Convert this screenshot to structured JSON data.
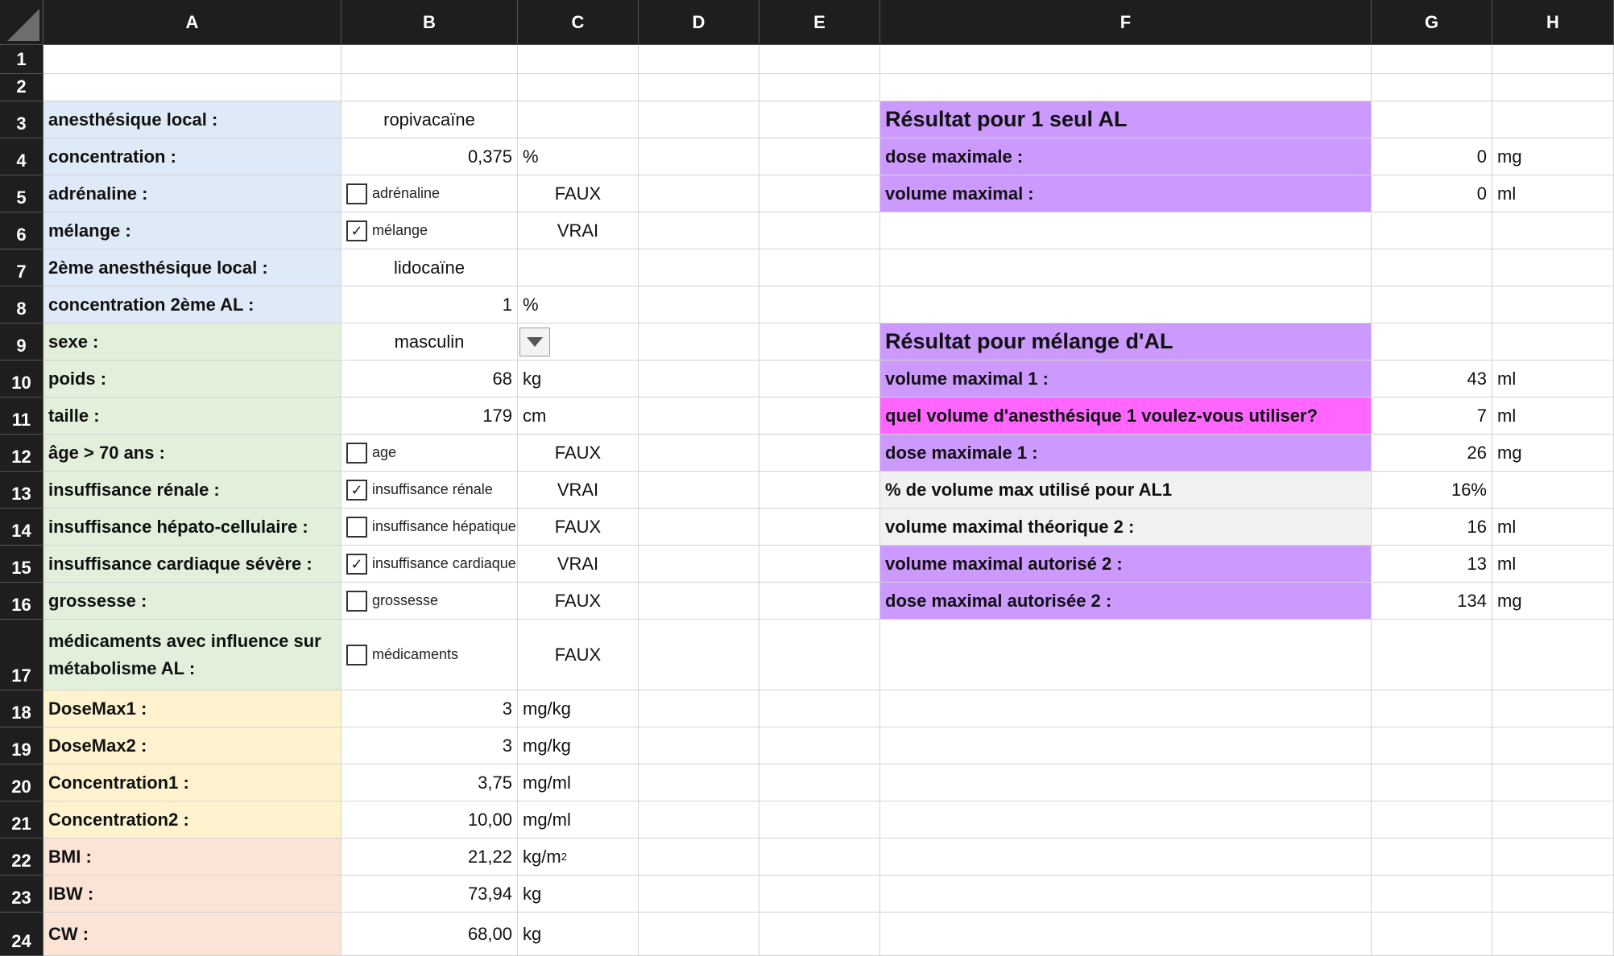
{
  "columns": [
    "A",
    "B",
    "C",
    "D",
    "E",
    "F",
    "G",
    "H"
  ],
  "rows": [
    "1",
    "2",
    "3",
    "4",
    "5",
    "6",
    "7",
    "8",
    "9",
    "10",
    "11",
    "12",
    "13",
    "14",
    "15",
    "16",
    "17",
    "18",
    "19",
    "20",
    "21",
    "22",
    "23",
    "24"
  ],
  "inputs": {
    "a3": "anesthésique local :",
    "b3": "ropivacaïne",
    "a4": "concentration :",
    "b4": "0,375",
    "c4": "%",
    "a5": "adrénaline :",
    "b5_label": "adrénaline",
    "b5_checked": false,
    "c5": "FAUX",
    "a6": "mélange :",
    "b6_label": "mélange",
    "b6_checked": true,
    "c6": "VRAI",
    "a7": "2ème anesthésique local :",
    "b7": "lidocaïne",
    "a8": "concentration 2ème AL :",
    "b8": "1",
    "c8": "%"
  },
  "patient": {
    "a9": "sexe :",
    "b9": "masculin",
    "a10": "poids :",
    "b10": "68",
    "c10": "kg",
    "a11": "taille :",
    "b11": "179",
    "c11": "cm",
    "a12": "âge > 70 ans :",
    "b12_label": "age",
    "b12_checked": false,
    "c12": "FAUX",
    "a13": "insuffisance rénale :",
    "b13_label": "insuffisance rénale",
    "b13_checked": true,
    "c13": "VRAI",
    "a14": "insuffisance hépato-cellulaire :",
    "b14_label": "insuffisance hépatique",
    "b14_checked": false,
    "c14": "FAUX",
    "a15": "insuffisance cardiaque sévère :",
    "b15_label": "insuffisance cardiaque",
    "b15_checked": true,
    "c15": "VRAI",
    "a16": "grossesse :",
    "b16_label": "grossesse",
    "b16_checked": false,
    "c16": "FAUX",
    "a17": "médicaments avec influence sur métabolisme AL :",
    "b17_label": "médicaments",
    "b17_checked": false,
    "c17": "FAUX"
  },
  "doses": {
    "a18": "DoseMax1 :",
    "b18": "3",
    "c18": "mg/kg",
    "a19": "DoseMax2 :",
    "b19": "3",
    "c19": "mg/kg",
    "a20": "Concentration1 :",
    "b20": "3,75",
    "c20": "mg/ml",
    "a21": "Concentration2 :",
    "b21": "10,00",
    "c21": "mg/ml"
  },
  "body": {
    "a22": "BMI :",
    "b22": "21,22",
    "c22": "kg/m",
    "c22_sup": "2",
    "a23": "IBW :",
    "b23": "73,94",
    "c23": "kg",
    "a24": "CW :",
    "b24": "68,00",
    "c24": "kg"
  },
  "result_single": {
    "title": "Résultat pour 1 seul AL",
    "f4": "dose maximale :",
    "g4": "0",
    "h4": "mg",
    "f5": "volume maximal :",
    "g5": "0",
    "h5": "ml"
  },
  "result_mix": {
    "title": "Résultat pour mélange d'AL",
    "f10": "volume maximal 1 :",
    "g10": "43",
    "h10": "ml",
    "f11": "quel volume d'anesthésique 1 voulez-vous utiliser?",
    "g11": "7",
    "h11": "ml",
    "f12": "dose maximale 1 :",
    "g12": "26",
    "h12": "mg",
    "f13": "% de volume max utilisé pour AL1",
    "g13": "16%",
    "f14": "volume maximal théorique 2 :",
    "g14": "16",
    "h14": "ml",
    "f15": "volume maximal autorisé 2 :",
    "g15": "13",
    "h15": "ml",
    "f16": "dose maximal autorisée 2 :",
    "g16": "134",
    "h16": "mg"
  },
  "colors": {
    "header": "#1e1e1e",
    "blue": "#deeaf7",
    "green": "#e2efdb",
    "yellow": "#fff3cf",
    "peach": "#fbe3d6",
    "purple": "#cc99ff",
    "magenta": "#ff66ff",
    "gray": "#f1f1f1"
  }
}
